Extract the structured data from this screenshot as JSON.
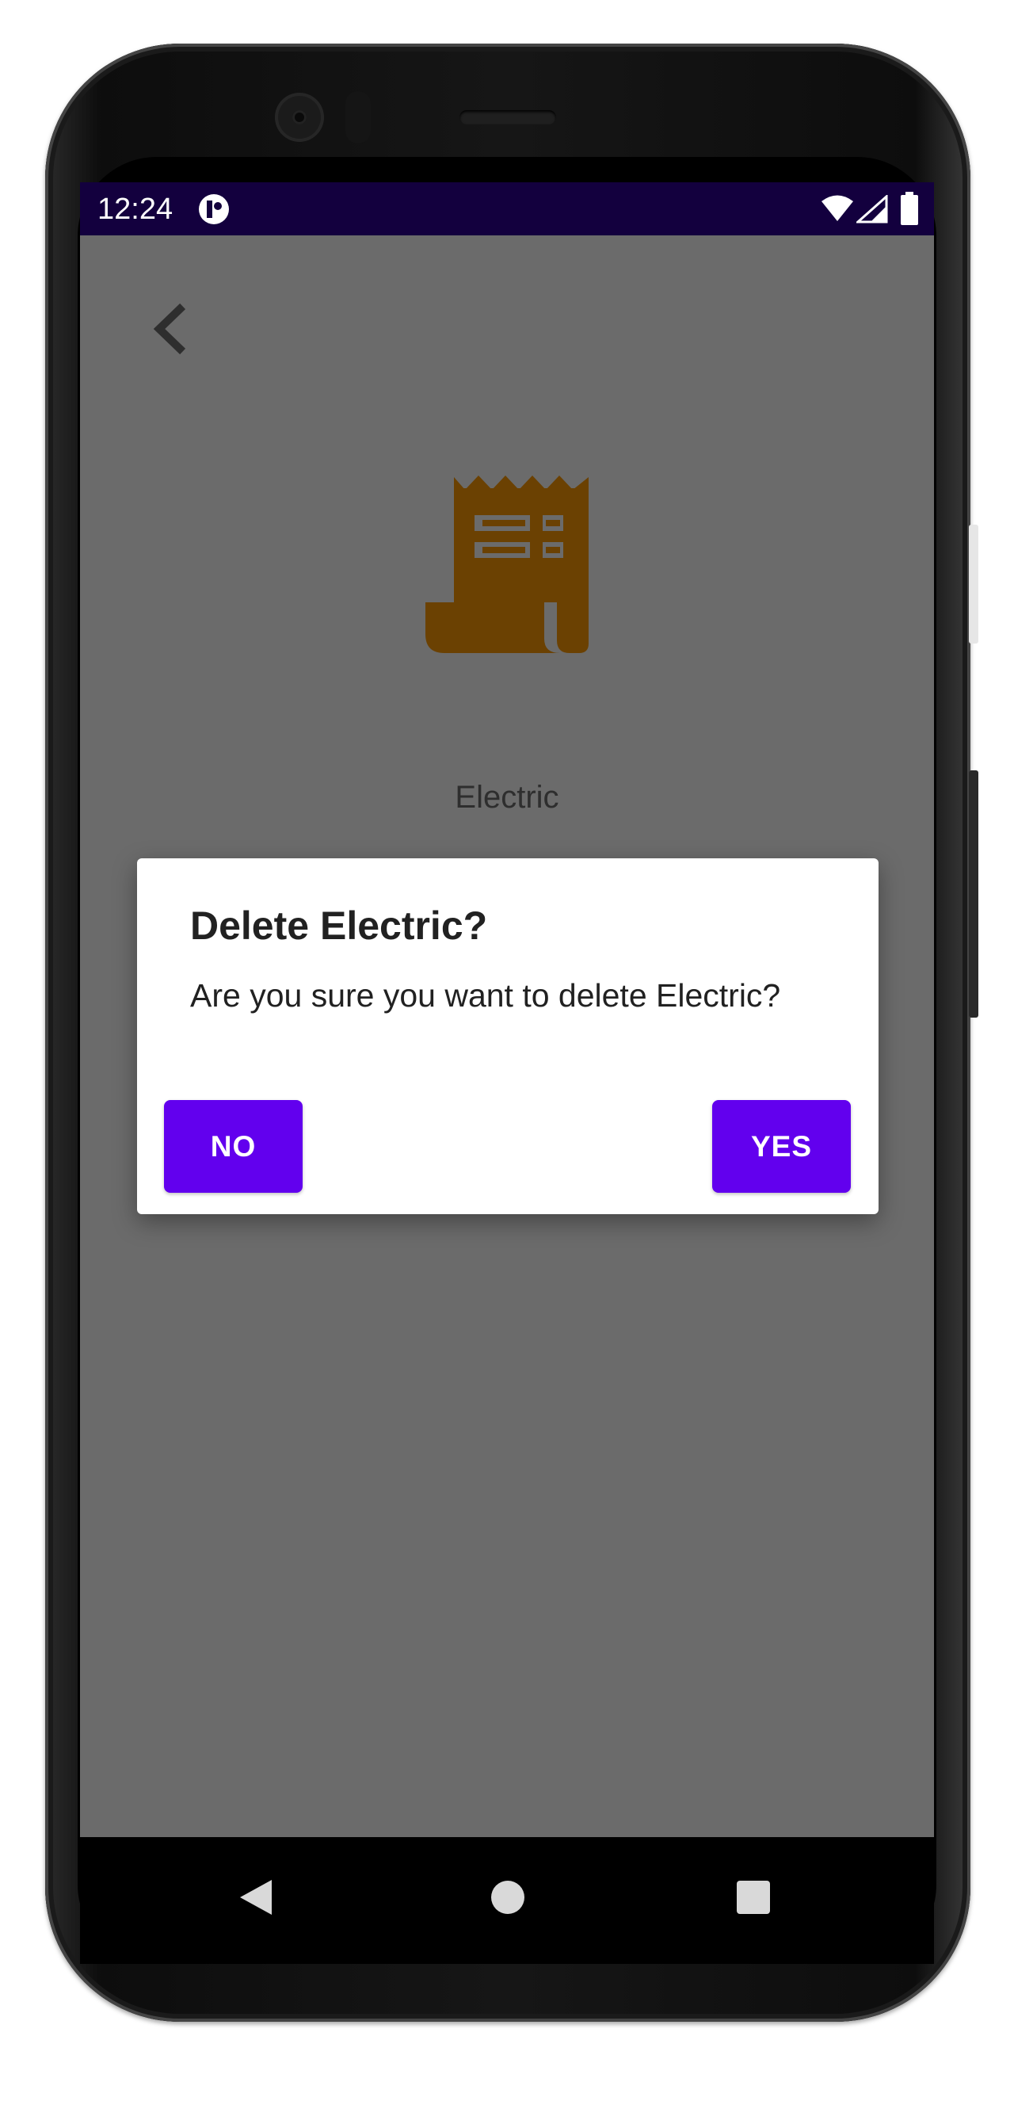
{
  "status_bar": {
    "time": "12:24",
    "app_icon": "app-notification-icon",
    "wifi_icon": "wifi-icon",
    "signal_icon": "cell-signal-icon",
    "battery_icon": "battery-icon"
  },
  "toolbar": {
    "back_icon": "chevron-left-icon"
  },
  "category": {
    "icon": "receipt-icon",
    "icon_color": "#6b4102",
    "name": "Electric"
  },
  "dialog": {
    "title": "Delete Electric?",
    "message": "Are you sure you want to delete Electric?",
    "no_label": "NO",
    "yes_label": "YES",
    "button_color": "#6200ee"
  },
  "navigation_bar": {
    "back_icon": "nav-back-icon",
    "home_icon": "nav-home-icon",
    "recents_icon": "nav-recents-icon"
  },
  "colors": {
    "status_bar": "#13003e",
    "scrim_background": "#6b6b6b"
  }
}
